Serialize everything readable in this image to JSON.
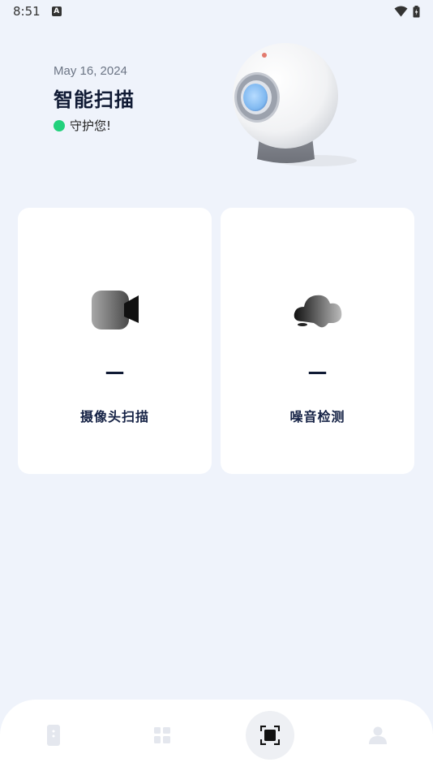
{
  "status_bar": {
    "time": "8:51",
    "notification_icon": "A"
  },
  "header": {
    "date": "May 16, 2024",
    "title": "智能扫描",
    "status_text": "守护您!",
    "status_color": "#22d17c"
  },
  "cards": [
    {
      "value": "—",
      "label": "摄像头扫描",
      "icon": "video-camera-icon"
    },
    {
      "value": "—",
      "label": "噪音检测",
      "icon": "cloud-icon"
    }
  ],
  "bottom_nav": {
    "items": [
      {
        "icon": "phone-icon",
        "active": false
      },
      {
        "icon": "grid-icon",
        "active": false
      },
      {
        "icon": "scan-icon",
        "active": true
      },
      {
        "icon": "user-icon",
        "active": false
      }
    ]
  }
}
